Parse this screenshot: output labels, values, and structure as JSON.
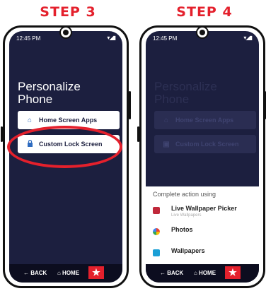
{
  "steps": [
    {
      "label": "STEP 3"
    },
    {
      "label": "STEP 4"
    }
  ],
  "phone": {
    "time": "12:45 PM",
    "status_icons": "▾◢▮",
    "title_line1": "Personalize",
    "title_line2": "Phone",
    "btn_home_apps": "Home Screen Apps",
    "btn_lock_screen": "Custom Lock Screen",
    "nav_back": "← BACK",
    "nav_home": "⌂ HOME",
    "nav_star": "★"
  },
  "sheet": {
    "header": "Complete action using",
    "options": [
      {
        "title": "Live Wallpaper Picker",
        "subtitle": "Live Wallpapers"
      },
      {
        "title": "Photos",
        "subtitle": ""
      },
      {
        "title": "Wallpapers",
        "subtitle": ""
      }
    ]
  },
  "colors": {
    "accent": "#e4202c",
    "screen": "#1c1f3f",
    "icon": "#2f6cc0"
  }
}
